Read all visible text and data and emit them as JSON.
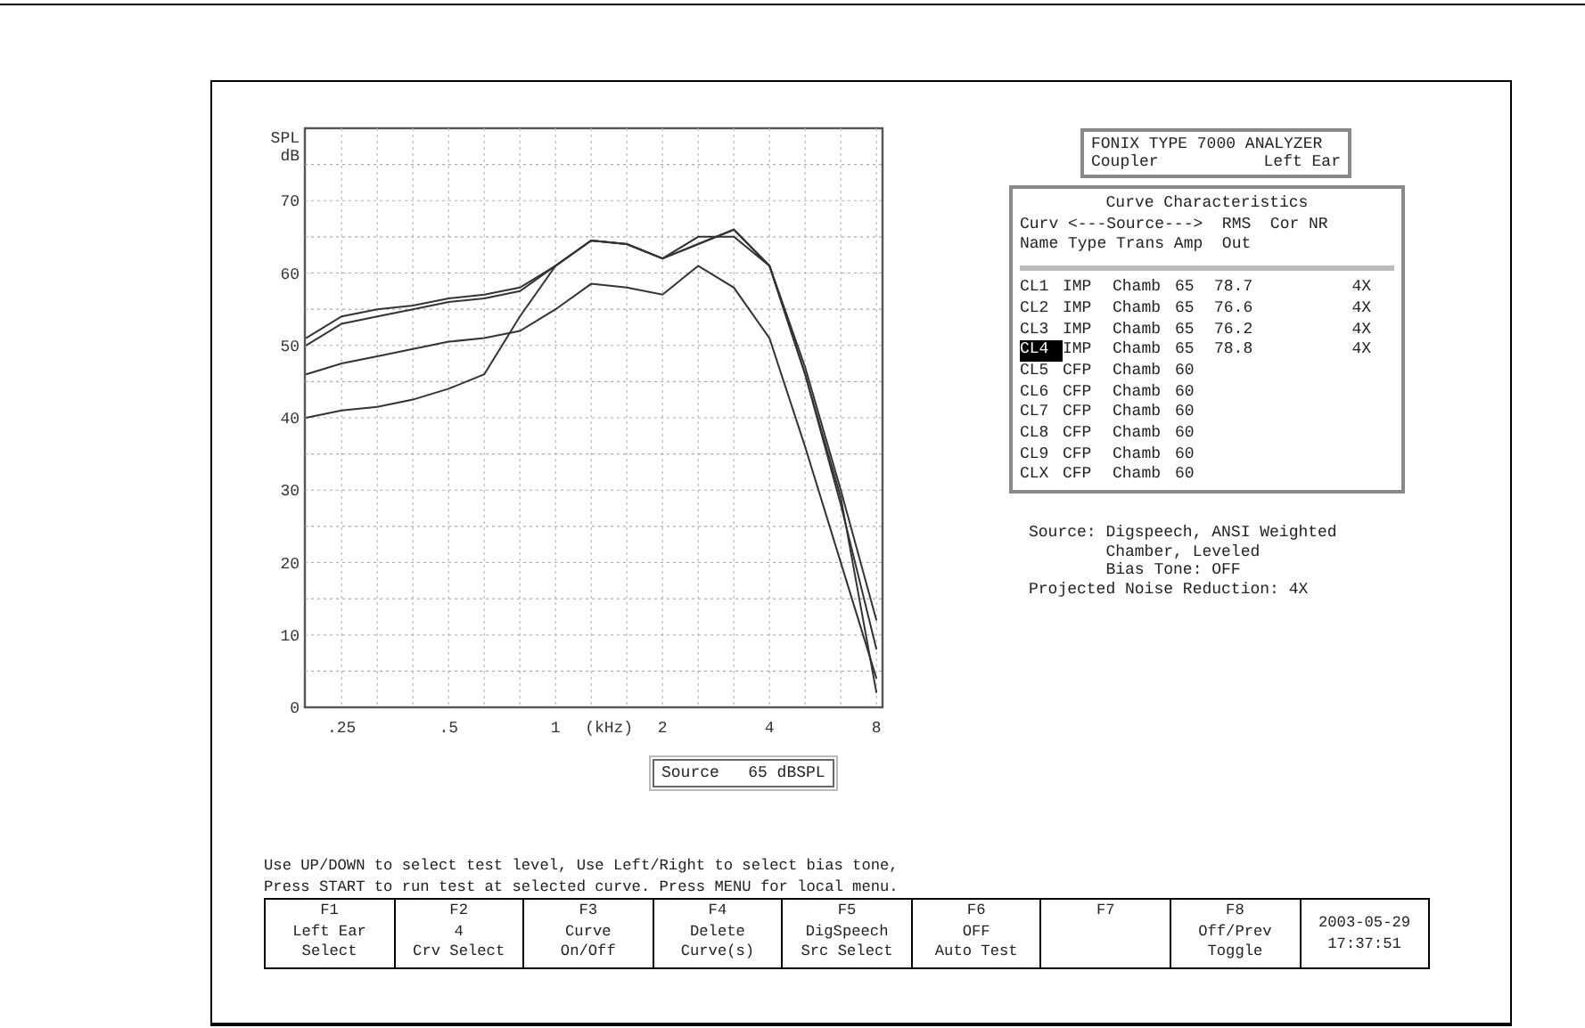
{
  "graph": {
    "chart_data": {
      "type": "line",
      "grid": true,
      "xlabel": "(kHz)",
      "ylabel": "SPL dB",
      "ylim": [
        0,
        80
      ],
      "yticks": [
        0,
        10,
        20,
        30,
        40,
        50,
        60,
        70
      ],
      "categories": [
        null,
        ".25",
        null,
        null,
        ".5",
        null,
        null,
        "1",
        null,
        null,
        "2",
        null,
        null,
        "4",
        null,
        null,
        "8"
      ],
      "series": [
        {
          "color": "#333333",
          "values": [
            50,
            53,
            54,
            55,
            56,
            56.5,
            57.5,
            61,
            64.5,
            64,
            62,
            64,
            66,
            61,
            47,
            30,
            12
          ]
        },
        {
          "color": "#333333",
          "values": [
            51,
            54,
            55,
            55.5,
            56.5,
            57,
            58,
            61,
            64.5,
            64,
            62,
            65,
            65,
            61,
            46,
            28,
            8
          ]
        },
        {
          "color": "#333333",
          "values": [
            46,
            47.5,
            48.5,
            49.5,
            50.5,
            51,
            52,
            55,
            58.5,
            58,
            57,
            61,
            58,
            51,
            36,
            20,
            4
          ]
        },
        {
          "color": "#333333",
          "values": [
            40,
            41,
            41.5,
            42.5,
            44,
            46,
            54,
            61,
            64.5,
            64,
            62,
            64,
            66,
            61,
            46,
            29,
            2
          ]
        }
      ]
    },
    "source_label": "Source   65 dBSPL"
  },
  "analyzer": {
    "title": "FONIX TYPE 7000 ANALYZER",
    "mode": "Coupler",
    "ear": "Left Ear"
  },
  "curve_table": {
    "title": "Curve Characteristics",
    "header_lines": [
      "Curv <---Source--->  RMS  Cor NR",
      "Name Type Trans Amp  Out"
    ],
    "rows": [
      {
        "name": "CL1",
        "type": "IMP",
        "trans": "Chamb",
        "amp": "65",
        "rms_out": "78.7",
        "nr": "4X",
        "selected": false
      },
      {
        "name": "CL2",
        "type": "IMP",
        "trans": "Chamb",
        "amp": "65",
        "rms_out": "76.6",
        "nr": "4X",
        "selected": false
      },
      {
        "name": "CL3",
        "type": "IMP",
        "trans": "Chamb",
        "amp": "65",
        "rms_out": "76.2",
        "nr": "4X",
        "selected": false
      },
      {
        "name": "CL4",
        "type": "IMP",
        "trans": "Chamb",
        "amp": "65",
        "rms_out": "78.8",
        "nr": "4X",
        "selected": true
      },
      {
        "name": "CL5",
        "type": "CFP",
        "trans": "Chamb",
        "amp": "60",
        "selected": false
      },
      {
        "name": "CL6",
        "type": "CFP",
        "trans": "Chamb",
        "amp": "60",
        "selected": false
      },
      {
        "name": "CL7",
        "type": "CFP",
        "trans": "Chamb",
        "amp": "60",
        "selected": false
      },
      {
        "name": "CL8",
        "type": "CFP",
        "trans": "Chamb",
        "amp": "60",
        "selected": false
      },
      {
        "name": "CL9",
        "type": "CFP",
        "trans": "Chamb",
        "amp": "60",
        "selected": false
      },
      {
        "name": "CLX",
        "type": "CFP",
        "trans": "Chamb",
        "amp": "60",
        "selected": false
      }
    ]
  },
  "source_info": [
    "Source: Digspeech, ANSI Weighted",
    "        Chamber, Leveled",
    "        Bias Tone: OFF",
    "Projected Noise Reduction: 4X"
  ],
  "instructions": [
    "Use UP/DOWN to select test level, Use Left/Right to select bias tone,",
    "Press START to run test at selected curve. Press MENU for local menu."
  ],
  "function_keys": [
    {
      "lines": [
        "F1",
        "Left Ear",
        "Select"
      ]
    },
    {
      "lines": [
        "F2",
        "4",
        "Crv Select"
      ]
    },
    {
      "lines": [
        "F3",
        "Curve",
        "On/Off"
      ]
    },
    {
      "lines": [
        "F4",
        "Delete",
        "Curve(s)"
      ]
    },
    {
      "lines": [
        "F5",
        "DigSpeech",
        "Src Select"
      ]
    },
    {
      "lines": [
        "F6",
        "OFF",
        "Auto Test"
      ]
    },
    {
      "lines": [
        "F7"
      ]
    },
    {
      "lines": [
        "F8",
        "Off/Prev",
        "Toggle"
      ]
    }
  ],
  "datetime": [
    "2003-05-29",
    "17:37:51"
  ]
}
